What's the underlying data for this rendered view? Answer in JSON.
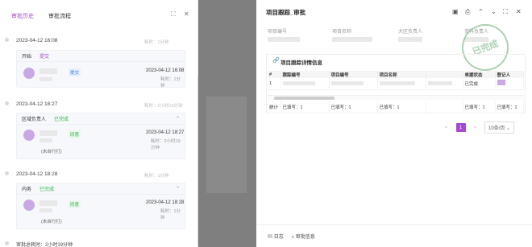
{
  "left_panel": {
    "tabs": [
      "审批历史",
      "审批流程"
    ],
    "entries": [
      {
        "date": "2023-04-12 16:08",
        "right": "耗时：1分钟",
        "header_left": "开始",
        "header_right": "提交",
        "tag": "提交",
        "time": "2023-04-12 16:08",
        "time_sub": "耗时：1分钟"
      },
      {
        "date": "2023-04-12 18:27",
        "right": "耗时：2小时19分钟",
        "header_left": "区域负责人",
        "header_right": "已完成",
        "tag": "同意",
        "time": "2023-04-12 18:27",
        "time_sub": "耗时：2小时19分钟",
        "signed": "(未自行打)"
      },
      {
        "date": "2023-04-12 18:28",
        "right": "耗时：1分钟",
        "header_left": "内务",
        "header_right": "已完成",
        "tag": "同意",
        "time": "2023-04-12 18:28",
        "time_sub": "耗时：1分钟",
        "signed": "(未自行打)"
      }
    ],
    "total": "审批总耗时：2小时19分钟"
  },
  "right_panel": {
    "title": "项目跟踪_审批",
    "fields": [
      "项目编号",
      "项目名称",
      "大区负责人",
      "资料负责人"
    ],
    "stamp_text": "已完成",
    "section_title": "项目跟踪详情信息",
    "table": {
      "headers": [
        "#",
        "跟踪编号",
        "项目编号",
        "项目名称",
        "",
        "单据状态",
        "登记人"
      ],
      "rows": [
        {
          "index": "1",
          "status": "已完成"
        }
      ],
      "summary": [
        "统计",
        "已填写：1",
        "已填写：1",
        "已填写：1",
        "",
        "已填写：1",
        "已填写：1"
      ]
    },
    "pagination": {
      "prev": "<",
      "page": "1",
      "next": ">",
      "size": "10条/页"
    },
    "footer": {
      "log": "日志",
      "info": "审批信息"
    }
  }
}
